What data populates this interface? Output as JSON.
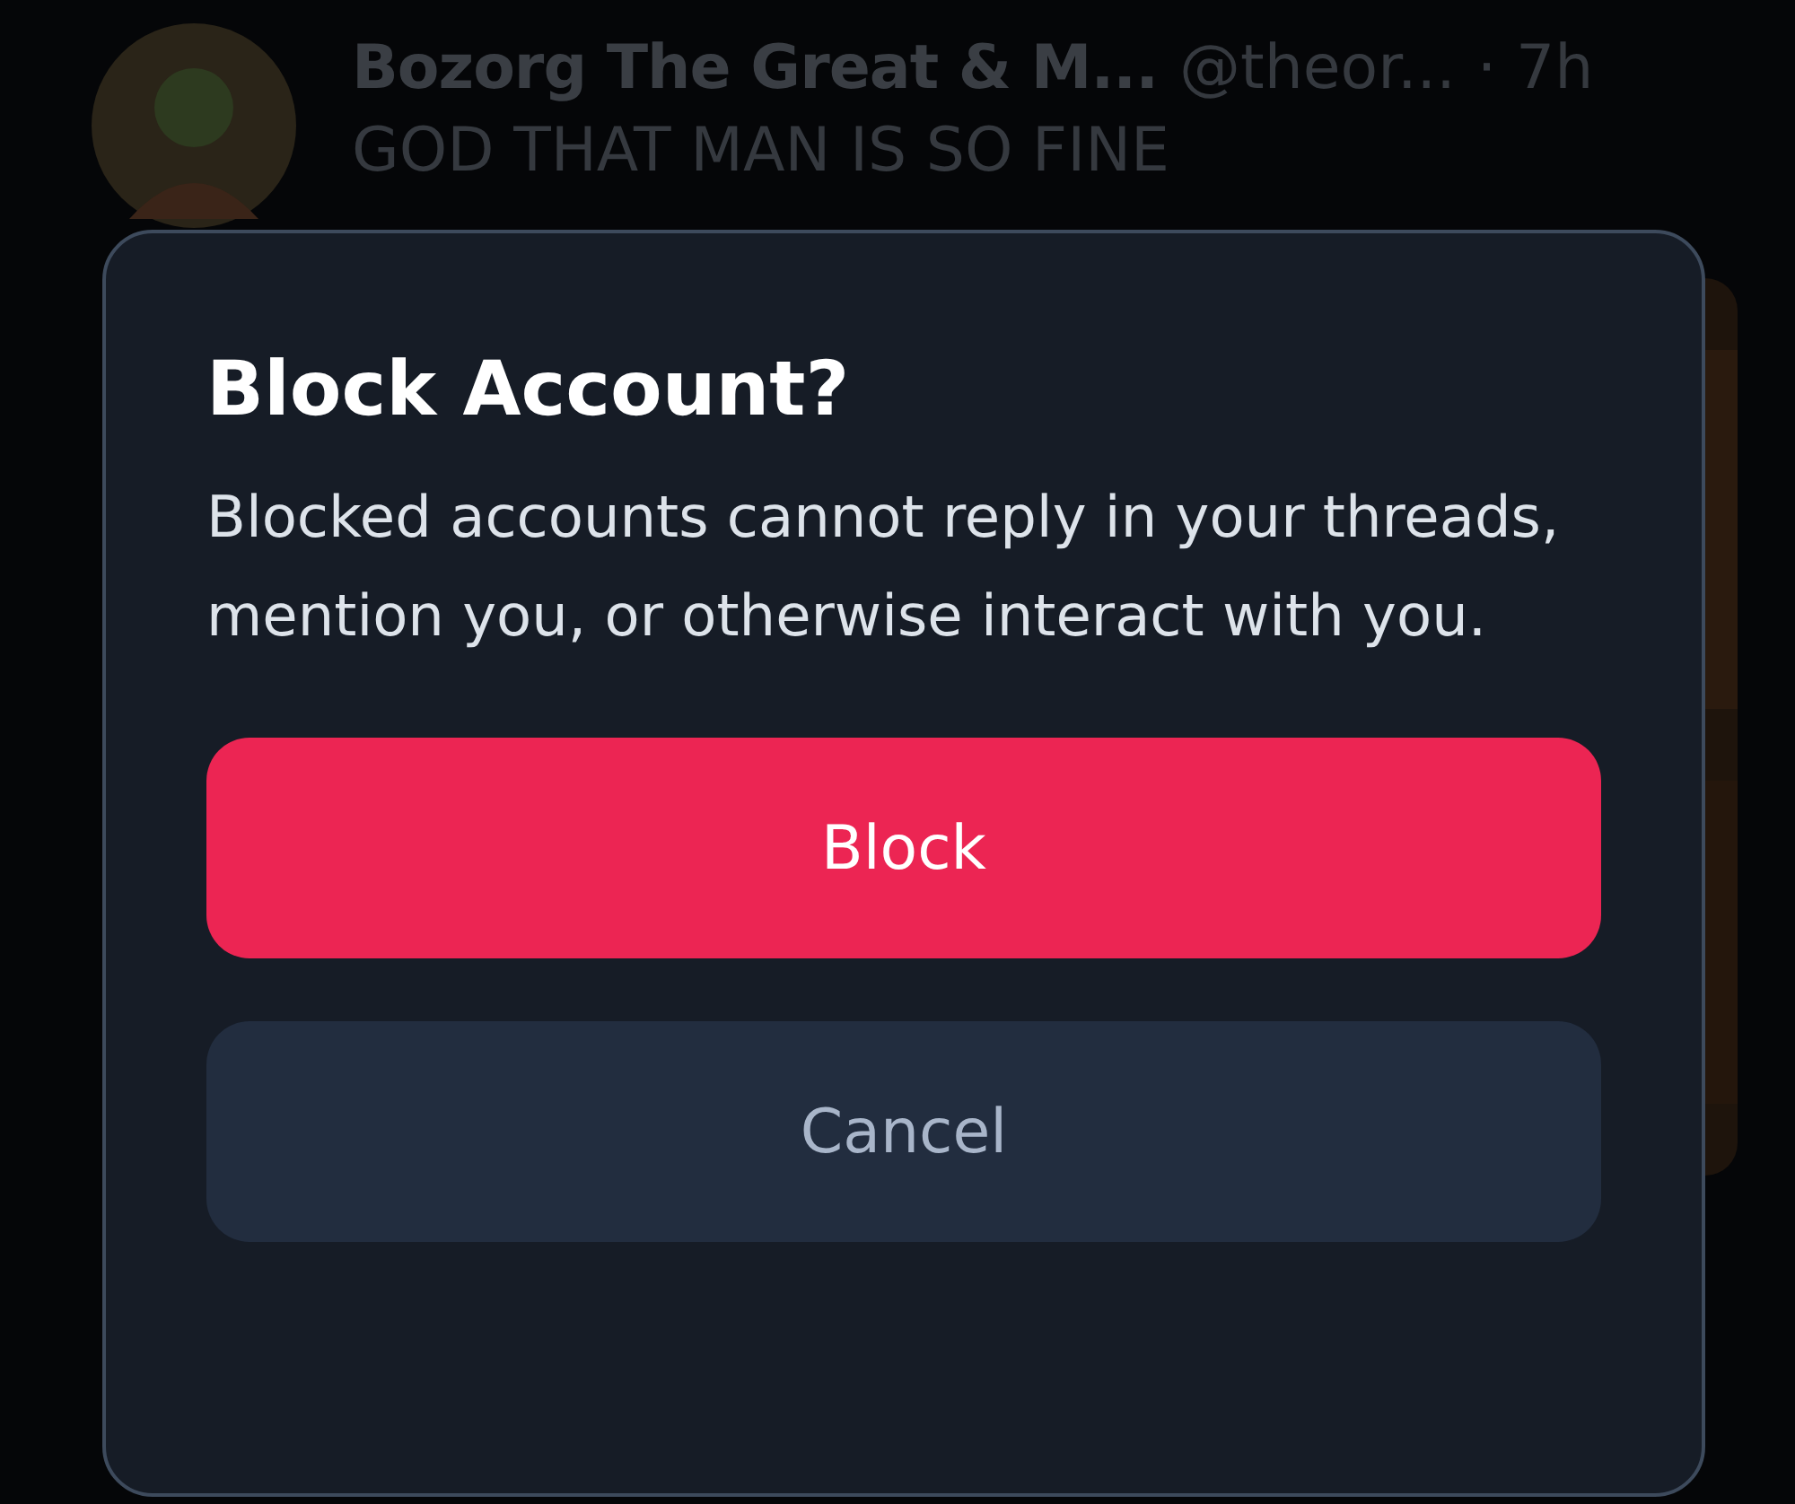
{
  "post": {
    "author": "Bozorg The Great & M...",
    "handle": "@theor...",
    "time": "· 7h",
    "text": "GOD THAT MAN IS SO FINE"
  },
  "dialog": {
    "title": "Block Account?",
    "message": "Blocked accounts cannot reply in your threads, mention you, or otherwise interact with you.",
    "buttons": [
      {
        "label": "Block",
        "kind": "primary"
      },
      {
        "label": "Cancel",
        "kind": "secondary"
      }
    ]
  }
}
